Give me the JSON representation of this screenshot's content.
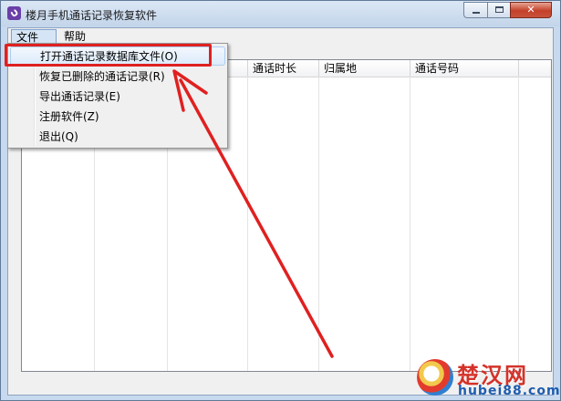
{
  "window": {
    "title": "楼月手机通话记录恢复软件",
    "close_glyph": "✕"
  },
  "menubar": {
    "file": "文件(F)",
    "help": "帮助(H)"
  },
  "grid": {
    "columns": [
      "",
      "",
      "",
      "通话时长",
      "归属地",
      "通话号码"
    ]
  },
  "file_menu": {
    "items": [
      "打开通话记录数据库文件(O)",
      "恢复已删除的通话记录(R)",
      "导出通话记录(E)",
      "注册软件(Z)",
      "退出(Q)"
    ]
  },
  "colors": {
    "annotation": "#e02020"
  },
  "watermark": {
    "title": "楚汉网",
    "url": "hubei88.com"
  }
}
